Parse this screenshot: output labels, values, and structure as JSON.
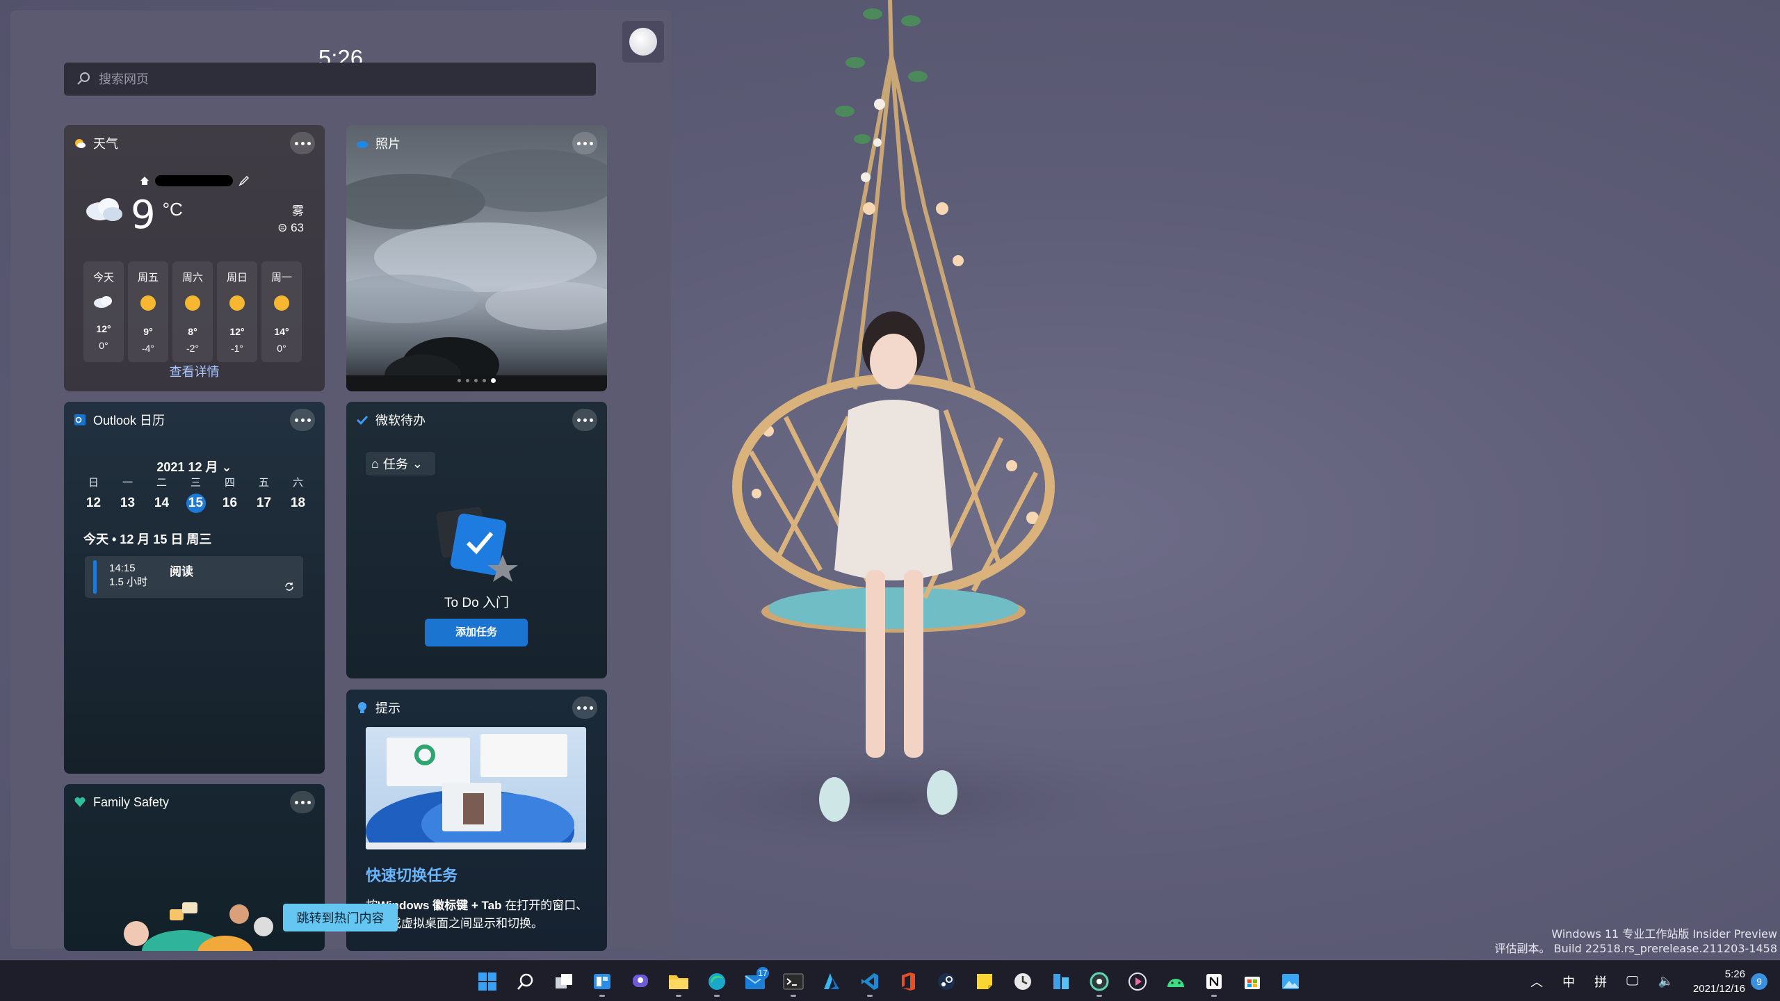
{
  "clock": "5:26",
  "search": {
    "placeholder": "搜索网页"
  },
  "weather": {
    "title": "天气",
    "temperature": "9",
    "unit": "°C",
    "condition": "雾",
    "aqi": "63",
    "days": [
      {
        "name": "今天",
        "icon": "cloud-icon",
        "hi": "12°",
        "lo": "0°"
      },
      {
        "name": "周五",
        "icon": "sun-icon",
        "hi": "9°",
        "lo": "-4°"
      },
      {
        "name": "周六",
        "icon": "sun-icon",
        "hi": "8°",
        "lo": "-2°"
      },
      {
        "name": "周日",
        "icon": "sun-icon",
        "hi": "12°",
        "lo": "-1°"
      },
      {
        "name": "周一",
        "icon": "sun-icon",
        "hi": "14°",
        "lo": "0°"
      }
    ],
    "link": "查看详情"
  },
  "photos": {
    "title": "照片",
    "dots": 5,
    "active_dot": 5
  },
  "calendar": {
    "title": "Outlook 日历",
    "month": "2021 12 月",
    "weekdays": [
      "日",
      "一",
      "二",
      "三",
      "四",
      "五",
      "六"
    ],
    "dates": [
      "12",
      "13",
      "14",
      "15",
      "16",
      "17",
      "18"
    ],
    "today_index": 3,
    "today_label": "今天 • 12 月 15 日 周三",
    "event": {
      "time": "14:15",
      "duration": "1.5 小时",
      "title": "阅读"
    }
  },
  "todo": {
    "title": "微软待办",
    "list": "任务",
    "empty_title": "To Do 入门",
    "add_button": "添加任务"
  },
  "tips": {
    "title": "提示",
    "heading": "快速切换任务",
    "text_prefix": "按",
    "text_bold": "Windows 徽标键",
    "text_bold2": " + Tab",
    "text_suffix": " 在打开的窗口、应用或虚拟桌面之间显示和切换。"
  },
  "family": {
    "title": "Family Safety"
  },
  "jump_button": "跳转到热门内容",
  "watermark": {
    "line1": "Windows 11 专业工作站版 Insider Preview",
    "line2": "评估副本。 Build 22518.rs_prerelease.211203-1458"
  },
  "taskbar": {
    "apps": [
      {
        "name": "start-button",
        "icon": "windows-logo-icon"
      },
      {
        "name": "search-button",
        "icon": "search-icon"
      },
      {
        "name": "task-view-button",
        "icon": "task-view-icon"
      },
      {
        "name": "widgets-button",
        "icon": "widgets-icon"
      },
      {
        "name": "chat-button",
        "icon": "chat-icon"
      },
      {
        "name": "file-explorer-button",
        "icon": "folder-icon"
      },
      {
        "name": "edge-button",
        "icon": "edge-icon"
      },
      {
        "name": "mail-button",
        "icon": "mail-icon",
        "badge": "17"
      },
      {
        "name": "terminal-button",
        "icon": "terminal-icon"
      },
      {
        "name": "azure-button",
        "icon": "azure-icon"
      },
      {
        "name": "vscode-button",
        "icon": "vscode-icon"
      },
      {
        "name": "office-button",
        "icon": "office-icon"
      },
      {
        "name": "steam-button",
        "icon": "steam-icon"
      },
      {
        "name": "sticky-notes-button",
        "icon": "sticky-notes-icon"
      },
      {
        "name": "clock-app-button",
        "icon": "clock-icon"
      },
      {
        "name": "windows-store-button",
        "icon": "store-icon"
      },
      {
        "name": "app-circle-button",
        "icon": "circle-app-icon"
      },
      {
        "name": "media-player-button",
        "icon": "play-icon"
      },
      {
        "name": "android-button",
        "icon": "android-icon"
      },
      {
        "name": "notion-button",
        "icon": "notion-icon"
      },
      {
        "name": "ms-store-button",
        "icon": "ms-store-icon"
      },
      {
        "name": "photos-button",
        "icon": "photos-app-icon"
      }
    ],
    "tray": {
      "ime_lang": "中",
      "ime_mode": "拼",
      "time": "5:26",
      "date": "2021/12/16",
      "notifications": "9"
    }
  }
}
